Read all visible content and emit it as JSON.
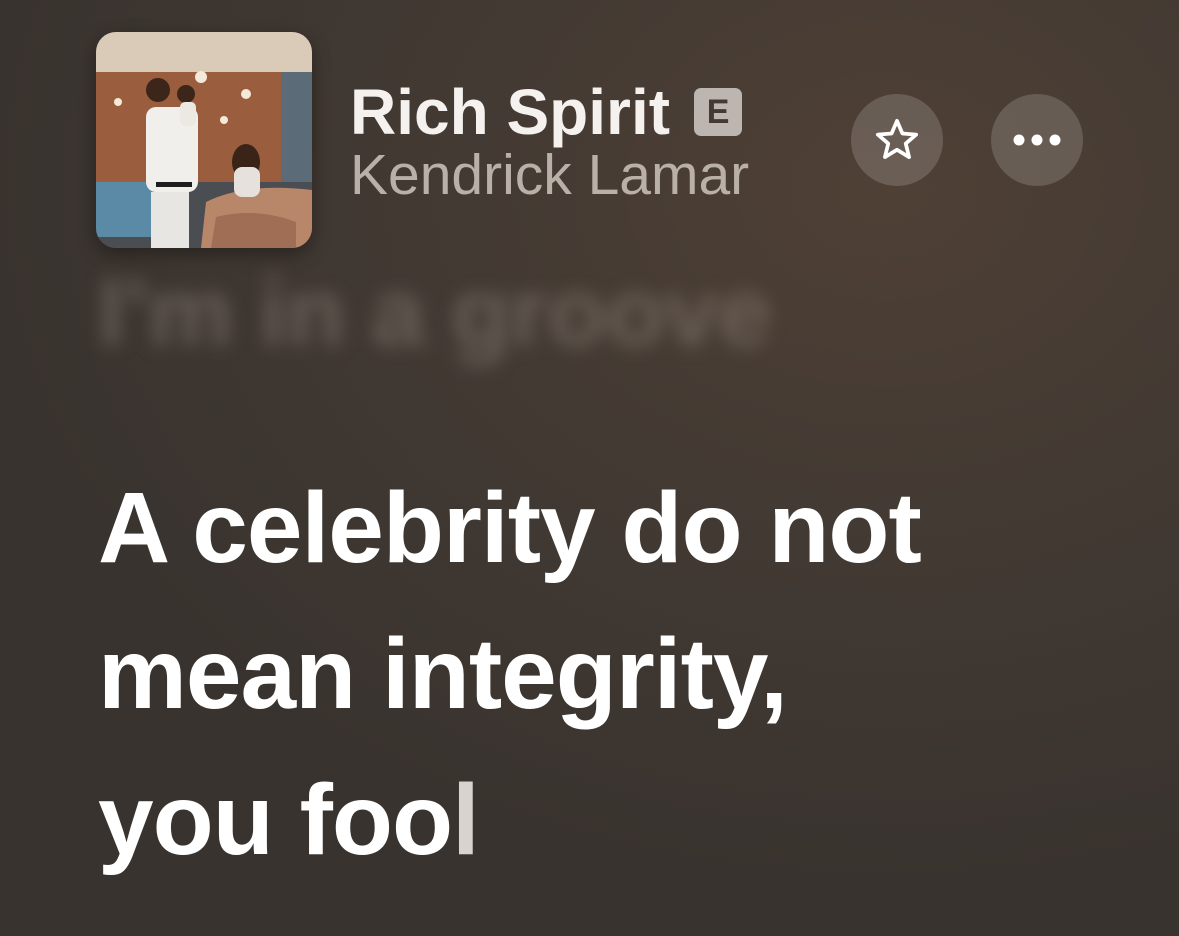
{
  "now_playing": {
    "title": "Rich Spirit",
    "explicit_badge": "E",
    "artist": "Kendrick Lamar",
    "artwork_icon": "album-artwork"
  },
  "actions": {
    "favorite_icon": "star-icon",
    "more_icon": "ellipsis-icon"
  },
  "lyrics": {
    "previous_line": "I'm in a groove",
    "current_line_1": "A celebrity do not",
    "current_line_2": "mean integrity,",
    "current_line_3_sung": "you foo",
    "current_line_3_unsung": "l"
  },
  "colors": {
    "background": "#433a33",
    "lyric_active": "#ffffff",
    "artist_text": "#b9b0a8",
    "button_bg": "rgba(255,255,255,0.16)"
  }
}
